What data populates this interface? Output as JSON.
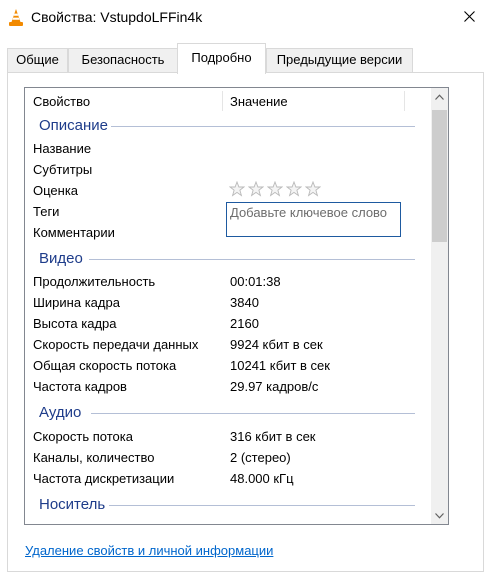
{
  "window": {
    "title": "Свойства: VstupdoLFFin4k"
  },
  "tabs": [
    {
      "label": "Общие"
    },
    {
      "label": "Безопасность"
    },
    {
      "label": "Подробно"
    },
    {
      "label": "Предыдущие версии"
    }
  ],
  "columns": {
    "property": "Свойство",
    "value": "Значение"
  },
  "groups": {
    "description": {
      "label": "Описание",
      "rows": [
        {
          "name": "Название",
          "value": ""
        },
        {
          "name": "Субтитры",
          "value": ""
        },
        {
          "name": "Оценка",
          "value": ""
        },
        {
          "name": "Теги",
          "value": ""
        },
        {
          "name": "Комментарии",
          "value": ""
        }
      ],
      "rating_stars": 0,
      "tags_placeholder": "Добавьте ключевое слово"
    },
    "video": {
      "label": "Видео",
      "rows": [
        {
          "name": "Продолжительность",
          "value": "00:01:38"
        },
        {
          "name": "Ширина кадра",
          "value": "3840"
        },
        {
          "name": "Высота кадра",
          "value": "2160"
        },
        {
          "name": "Скорость передачи данных",
          "value": "9924 кбит в сек"
        },
        {
          "name": "Общая скорость потока",
          "value": "10241 кбит в сек"
        },
        {
          "name": "Частота кадров",
          "value": "29.97 кадров/с"
        }
      ]
    },
    "audio": {
      "label": "Аудио",
      "rows": [
        {
          "name": "Скорость потока",
          "value": "316 кбит в сек"
        },
        {
          "name": "Каналы, количество",
          "value": "2 (стерео)"
        },
        {
          "name": "Частота дискретизации",
          "value": "48.000 кГц"
        }
      ]
    },
    "media": {
      "label": "Носитель"
    }
  },
  "footer": {
    "remove_link": "Удаление свойств и личной информации"
  },
  "colors": {
    "group_label": "#1e3c8a",
    "link": "#0066cc",
    "tags_border": "#1e5aa0"
  },
  "icons": {
    "app": "vlc-cone-icon",
    "close": "close-icon",
    "rating": "star-icon",
    "scroll_up": "chevron-up-icon",
    "scroll_down": "chevron-down-icon"
  }
}
